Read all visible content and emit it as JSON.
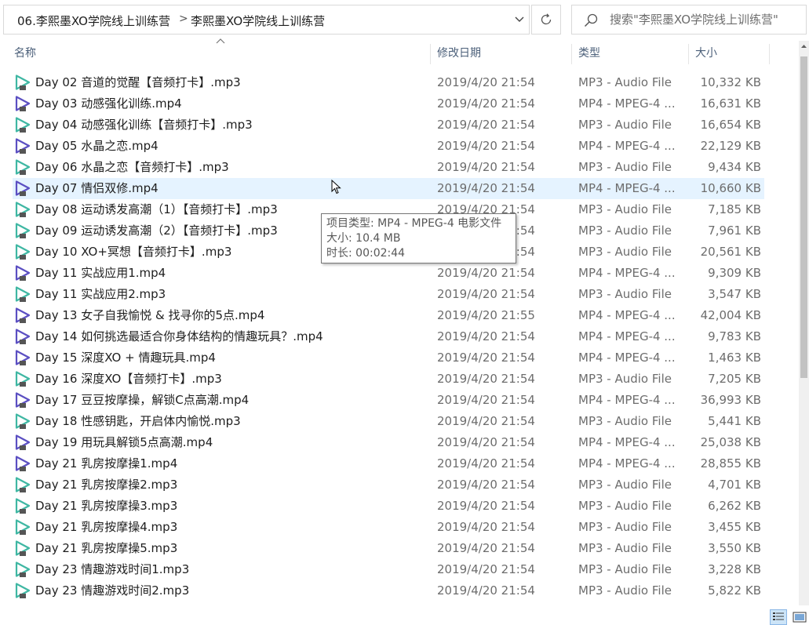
{
  "address_bar": {
    "breadcrumbs": [
      "06.李熙墨XO学院线上训练营",
      "李熙墨XO学院线上训练营"
    ],
    "separator": ">"
  },
  "search": {
    "placeholder": "搜索\"李熙墨XO学院线上训练营\""
  },
  "columns": {
    "name": "名称",
    "date": "修改日期",
    "type": "类型",
    "size": "大小"
  },
  "files": [
    {
      "name": "Day 02 音道的觉醒【音频打卡】.mp3",
      "date": "2019/4/20 21:54",
      "type": "MP3 - Audio File",
      "size": "10,332 KB",
      "kind": "mp3"
    },
    {
      "name": "Day 03 动感强化训练.mp4",
      "date": "2019/4/20 21:54",
      "type": "MP4 - MPEG-4 ...",
      "size": "16,631 KB",
      "kind": "mp4"
    },
    {
      "name": "Day 04 动感强化训练【音频打卡】.mp3",
      "date": "2019/4/20 21:54",
      "type": "MP3 - Audio File",
      "size": "16,654 KB",
      "kind": "mp3"
    },
    {
      "name": "Day 05 水晶之恋.mp4",
      "date": "2019/4/20 21:54",
      "type": "MP4 - MPEG-4 ...",
      "size": "22,129 KB",
      "kind": "mp4"
    },
    {
      "name": "Day 06 水晶之恋【音频打卡】.mp3",
      "date": "2019/4/20 21:54",
      "type": "MP3 - Audio File",
      "size": "9,434 KB",
      "kind": "mp3"
    },
    {
      "name": "Day 07 情侣双修.mp4",
      "date": "2019/4/20 21:54",
      "type": "MP4 - MPEG-4 ...",
      "size": "10,660 KB",
      "kind": "mp4"
    },
    {
      "name": "Day 08 运动诱发高潮（1）【音频打卡】.mp3",
      "date": "2019/4/20 21:54",
      "type": "MP3 - Audio File",
      "size": "7,185 KB",
      "kind": "mp3"
    },
    {
      "name": "Day 09 运动诱发高潮（2）【音频打卡】.mp3",
      "date": "2019/4/20 21:54",
      "type": "MP3 - Audio File",
      "size": "7,961 KB",
      "kind": "mp3"
    },
    {
      "name": "Day 10 XO+冥想【音频打卡】.mp3",
      "date": "2019/4/20 21:54",
      "type": "MP3 - Audio File",
      "size": "20,561 KB",
      "kind": "mp3"
    },
    {
      "name": "Day 11 实战应用1.mp4",
      "date": "2019/4/20 21:54",
      "type": "MP4 - MPEG-4 ...",
      "size": "9,309 KB",
      "kind": "mp4"
    },
    {
      "name": "Day 11 实战应用2.mp3",
      "date": "2019/4/20 21:54",
      "type": "MP3 - Audio File",
      "size": "3,547 KB",
      "kind": "mp3"
    },
    {
      "name": "Day 13 女子自我愉悦 & 找寻你的5点.mp4",
      "date": "2019/4/20 21:55",
      "type": "MP4 - MPEG-4 ...",
      "size": "42,004 KB",
      "kind": "mp4"
    },
    {
      "name": "Day 14 如何挑选最适合你身体结构的情趣玩具？.mp4",
      "date": "2019/4/20 21:54",
      "type": "MP4 - MPEG-4 ...",
      "size": "9,783 KB",
      "kind": "mp4"
    },
    {
      "name": "Day 15 深度XO + 情趣玩具.mp4",
      "date": "2019/4/20 21:54",
      "type": "MP4 - MPEG-4 ...",
      "size": "1,463 KB",
      "kind": "mp4"
    },
    {
      "name": "Day 16 深度XO【音频打卡】.mp3",
      "date": "2019/4/20 21:54",
      "type": "MP3 - Audio File",
      "size": "7,205 KB",
      "kind": "mp3"
    },
    {
      "name": "Day 17 豆豆按摩操，解锁C点高潮.mp4",
      "date": "2019/4/20 21:54",
      "type": "MP4 - MPEG-4 ...",
      "size": "36,993 KB",
      "kind": "mp4"
    },
    {
      "name": "Day 18 性感钥匙，开启体内愉悦.mp3",
      "date": "2019/4/20 21:54",
      "type": "MP3 - Audio File",
      "size": "5,441 KB",
      "kind": "mp3"
    },
    {
      "name": "Day 19 用玩具解锁5点高潮.mp4",
      "date": "2019/4/20 21:54",
      "type": "MP4 - MPEG-4 ...",
      "size": "25,038 KB",
      "kind": "mp4"
    },
    {
      "name": "Day 21 乳房按摩操1.mp4",
      "date": "2019/4/20 21:54",
      "type": "MP4 - MPEG-4 ...",
      "size": "28,855 KB",
      "kind": "mp4"
    },
    {
      "name": "Day 21 乳房按摩操2.mp3",
      "date": "2019/4/20 21:54",
      "type": "MP3 - Audio File",
      "size": "4,701 KB",
      "kind": "mp3"
    },
    {
      "name": "Day 21 乳房按摩操3.mp3",
      "date": "2019/4/20 21:54",
      "type": "MP3 - Audio File",
      "size": "6,262 KB",
      "kind": "mp3"
    },
    {
      "name": "Day 21 乳房按摩操4.mp3",
      "date": "2019/4/20 21:54",
      "type": "MP3 - Audio File",
      "size": "3,455 KB",
      "kind": "mp3"
    },
    {
      "name": "Day 21 乳房按摩操5.mp3",
      "date": "2019/4/20 21:54",
      "type": "MP3 - Audio File",
      "size": "3,550 KB",
      "kind": "mp3"
    },
    {
      "name": "Day 23 情趣游戏时间1.mp3",
      "date": "2019/4/20 21:54",
      "type": "MP3 - Audio File",
      "size": "3,228 KB",
      "kind": "mp3"
    },
    {
      "name": "Day 23 情趣游戏时间2.mp3",
      "date": "2019/4/20 21:54",
      "type": "MP3 - Audio File",
      "size": "5,822 KB",
      "kind": "mp3"
    }
  ],
  "hovered_index": 5,
  "tooltip": {
    "type_line": "项目类型: MP4 - MPEG-4 电影文件",
    "size_line": "大小: 10.4 MB",
    "duration_line": "时长: 00:02:44"
  },
  "colors": {
    "mp3_icon": "#3fb7a3",
    "mp4_icon": "#5b4fc2",
    "hover_row": "#e5f3ff",
    "header_text": "#4c607a"
  },
  "icons": {
    "file": "media-file-icon",
    "search": "search-icon",
    "refresh": "refresh-icon",
    "dropdown": "chevron-down-icon",
    "sort": "sort-ascending-icon"
  }
}
